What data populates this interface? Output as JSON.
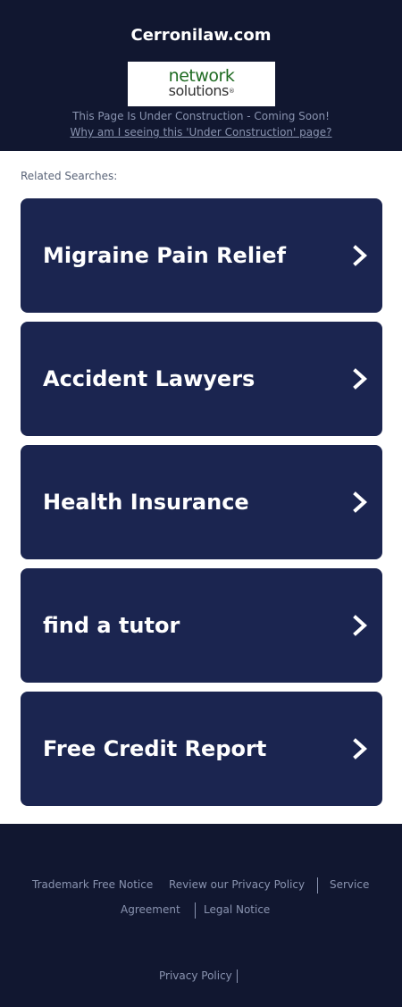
{
  "header": {
    "site_title": "Cerronilaw.com",
    "logo": {
      "line1": "network",
      "line2": "solutions",
      "reg_mark": "®"
    },
    "construction_text": "This Page Is Under Construction - Coming Soon!",
    "why_link": "Why am I seeing this 'Under Construction' page?"
  },
  "main": {
    "related_label": "Related Searches:",
    "searches": [
      {
        "label": "Migraine Pain Relief"
      },
      {
        "label": "Accident Lawyers"
      },
      {
        "label": "Health Insurance"
      },
      {
        "label": "find a tutor"
      },
      {
        "label": "Free Credit Report"
      }
    ]
  },
  "footer": {
    "trademark": "Trademark Free Notice",
    "privacy_review": "Review our Privacy Policy",
    "service_part1": "Service",
    "service_part2": "Agreement",
    "legal": "Legal Notice",
    "privacy_policy": "Privacy Policy"
  },
  "colors": {
    "header_bg": "#111730",
    "card_bg": "#1b2550",
    "muted_text": "#8a94b0",
    "logo_green": "#1f6b22"
  }
}
